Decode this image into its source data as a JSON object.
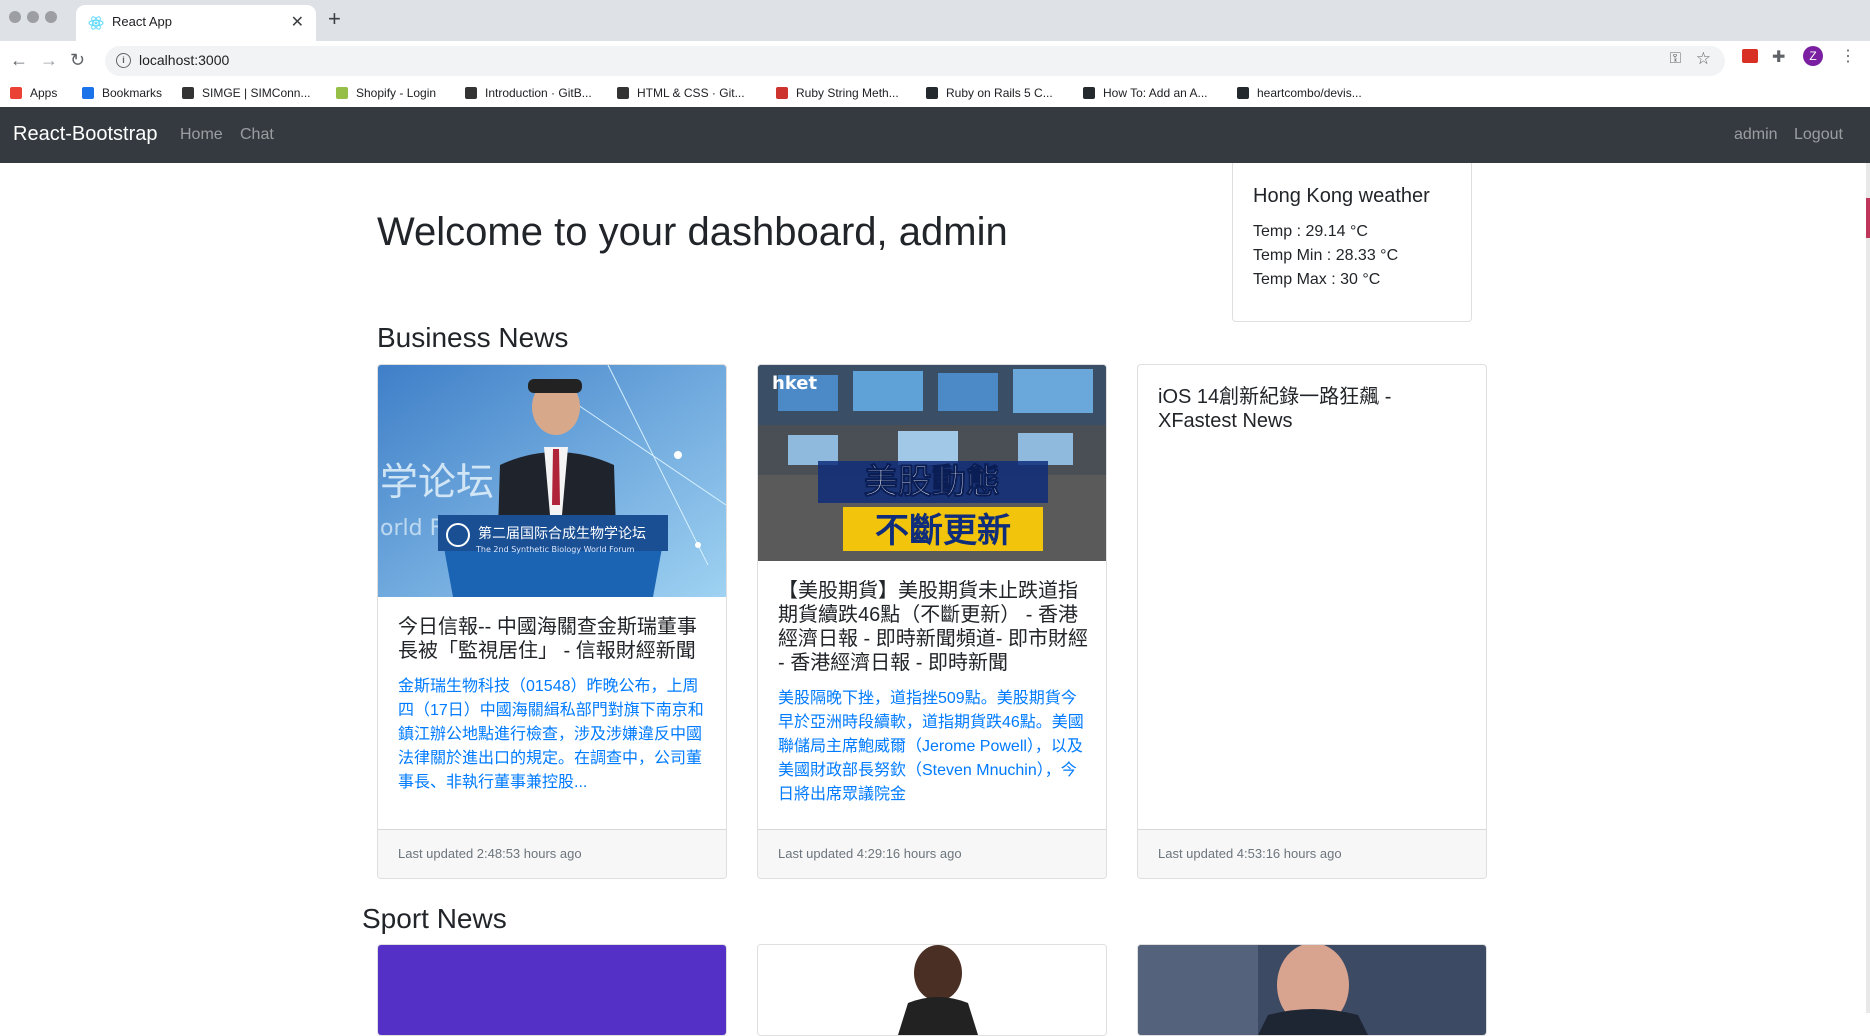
{
  "browser": {
    "tab_title": "React App",
    "url": "localhost:3000",
    "profile_initial": "Z",
    "bookmarks": [
      {
        "label": "Apps",
        "icon": "apps-grid-icon",
        "color": "#ea4335"
      },
      {
        "label": "Bookmarks",
        "icon": "star-icon",
        "color": "#1a73e8"
      },
      {
        "label": "SIMGE | SIMConn...",
        "icon": "globe-icon",
        "color": "#333333"
      },
      {
        "label": "Shopify - Login",
        "icon": "shopify-icon",
        "color": "#95bf47"
      },
      {
        "label": "Introduction · GitB...",
        "icon": "book-icon",
        "color": "#333333"
      },
      {
        "label": "HTML & CSS · Git...",
        "icon": "book-icon",
        "color": "#333333"
      },
      {
        "label": "Ruby String Meth...",
        "icon": "ruby-icon",
        "color": "#cc342d"
      },
      {
        "label": "Ruby on Rails 5 C...",
        "icon": "github-icon",
        "color": "#24292e"
      },
      {
        "label": "How To: Add an A...",
        "icon": "github-icon",
        "color": "#24292e"
      },
      {
        "label": "heartcombo/devis...",
        "icon": "github-icon",
        "color": "#24292e"
      }
    ]
  },
  "navbar": {
    "brand": "React-Bootstrap",
    "links": [
      "Home",
      "Chat"
    ],
    "user": "admin",
    "logout": "Logout"
  },
  "welcome": "Welcome to your dashboard, admin",
  "weather": {
    "title": "Hong Kong weather",
    "temp": "Temp : 29.14 °C",
    "temp_min": "Temp Min : 28.33 °C",
    "temp_max": "Temp Max : 30 °C"
  },
  "business_news": {
    "title": "Business News",
    "cards": [
      {
        "title": "今日信報-- 中國海關查金斯瑞董事長被「監視居住」 - 信報財經新聞",
        "text": "金斯瑞生物科技（01548）昨晚公布，上周四（17日）中國海關緝私部門對旗下南京和鎮江辦公地點進行檢查，涉及涉嫌違反中國法律關於進出口的規定。在調查中，公司董事長、非執行董事兼控股...",
        "updated": "Last updated 2:48:53 hours ago",
        "image_caption": "第二届国际合成生物学论坛"
      },
      {
        "title": "【美股期貨】美股期貨未止跌道指期貨續跌46點（不斷更新） - 香港經濟日報 - 即時新聞頻道- 即市財經 - 香港經濟日報 - 即時新聞",
        "text": "美股隔晚下挫，道指挫509點。美股期貨今早於亞洲時段續軟，道指期貨跌46點。美國聯儲局主席鮑威爾（Jerome Powell），以及美國財政部長努欽（Steven Mnuchin），今日將出席眾議院金",
        "updated": "Last updated 4:29:16 hours ago",
        "image_caption": "美股動態 不斷更新"
      },
      {
        "title": "iOS 14創新紀錄一路狂飆 - XFastest News",
        "text": "",
        "updated": "Last updated 4:53:16 hours ago"
      }
    ]
  },
  "sport_news": {
    "title": "Sport News"
  },
  "colors": {
    "navbar_bg": "#343a40",
    "link_blue": "#007bff",
    "footer_bg": "#f7f7f7"
  }
}
